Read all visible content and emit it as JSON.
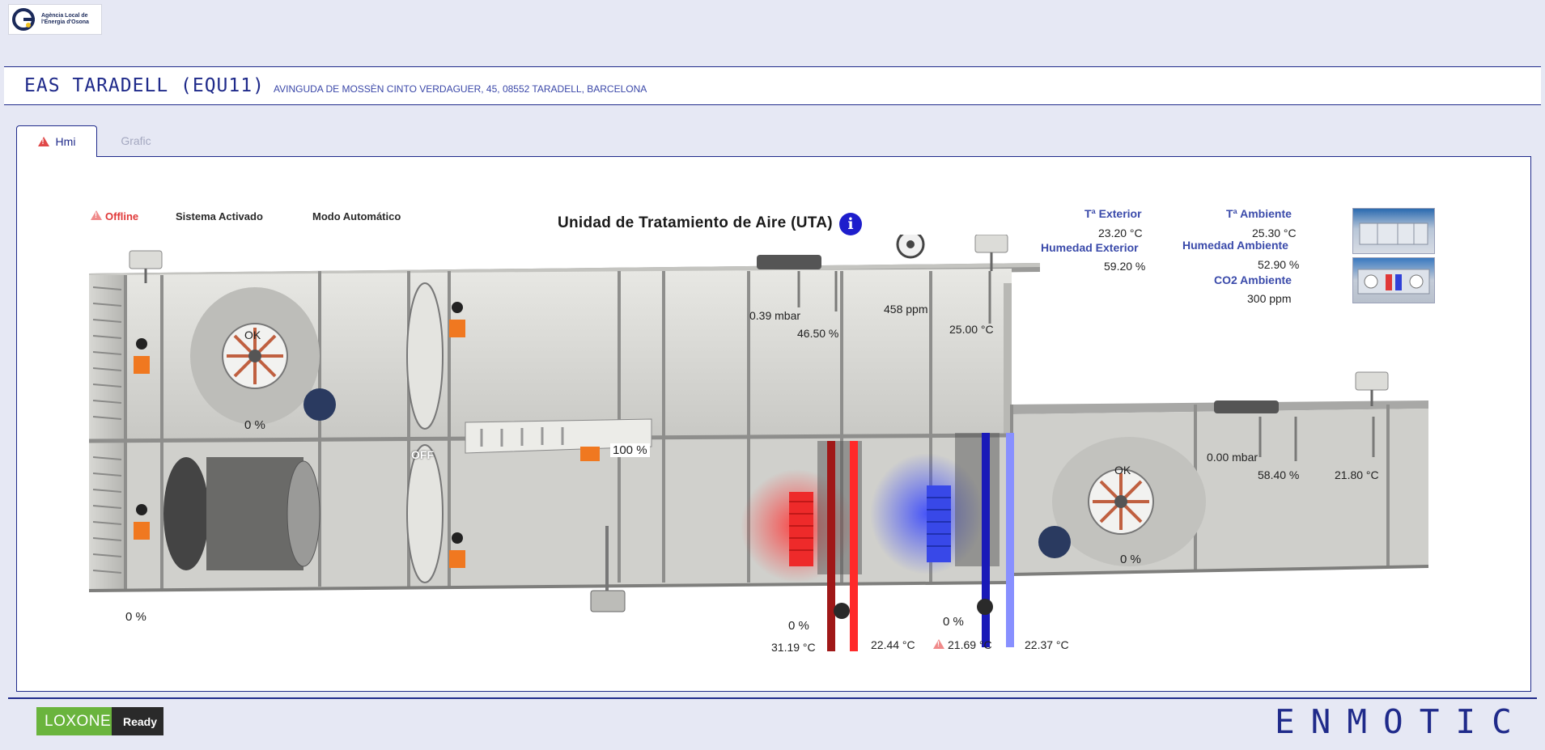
{
  "agency_logo": {
    "text": "Agència Local de\nl'Energia d'Osona"
  },
  "header": {
    "title": "EAS TARADELL (EQU11)",
    "address": "AVINGUDA DE MOSSÈN CINTO VERDAGUER, 45, 08552 TARADELL, BARCELONA"
  },
  "tabs": [
    {
      "label": "Hmi",
      "active": true,
      "warning": true
    },
    {
      "label": "Grafic",
      "active": false
    }
  ],
  "status": {
    "connection": "Offline",
    "system": "Sistema Activado",
    "mode": "Modo Automático"
  },
  "uta": {
    "title": "Unidad de Tratamiento de Aire (UTA)",
    "intake_fan_state": "OK",
    "intake_fan_pct": "0 %",
    "exhaust_fan_state": "OK",
    "exhaust_fan_pct": "0 %",
    "recovery_state": "OFF",
    "damper_bottom_left": "0 %",
    "mix_damper": "100 %",
    "supply_pressure": "0.39 mbar",
    "supply_humidity": "46.50 %",
    "supply_co2": "458 ppm",
    "supply_temp": "25.00 °C",
    "return_pressure": "0.00 mbar",
    "return_humidity": "58.40 %",
    "return_temp": "21.80 °C",
    "heating_valve": "0 %",
    "heating_in": "31.19 °C",
    "heating_out": "22.44 °C",
    "cooling_valve": "0 %",
    "cooling_in": "21.69 °C",
    "cooling_out": "22.37 °C"
  },
  "ambient": {
    "ext_temp_label": "Tª Exterior",
    "ext_temp": "23.20 °C",
    "ext_hum_label": "Humedad Exterior",
    "ext_hum": "59.20 %",
    "amb_temp_label": "Tª Ambiente",
    "amb_temp": "25.30 °C",
    "amb_hum_label": "Humedad Ambiente",
    "amb_hum": "52.90 %",
    "co2_label": "CO2 Ambiente",
    "co2": "300 ppm"
  },
  "footer": {
    "loxone_a": "LOXONE",
    "loxone_b": "Ready",
    "brand": "ENMOTIC"
  },
  "colors": {
    "accent": "#1f2a8a",
    "offline": "#e03838",
    "heating": "#e02020",
    "cooling": "#2830d8",
    "actuator": "#f07820"
  }
}
